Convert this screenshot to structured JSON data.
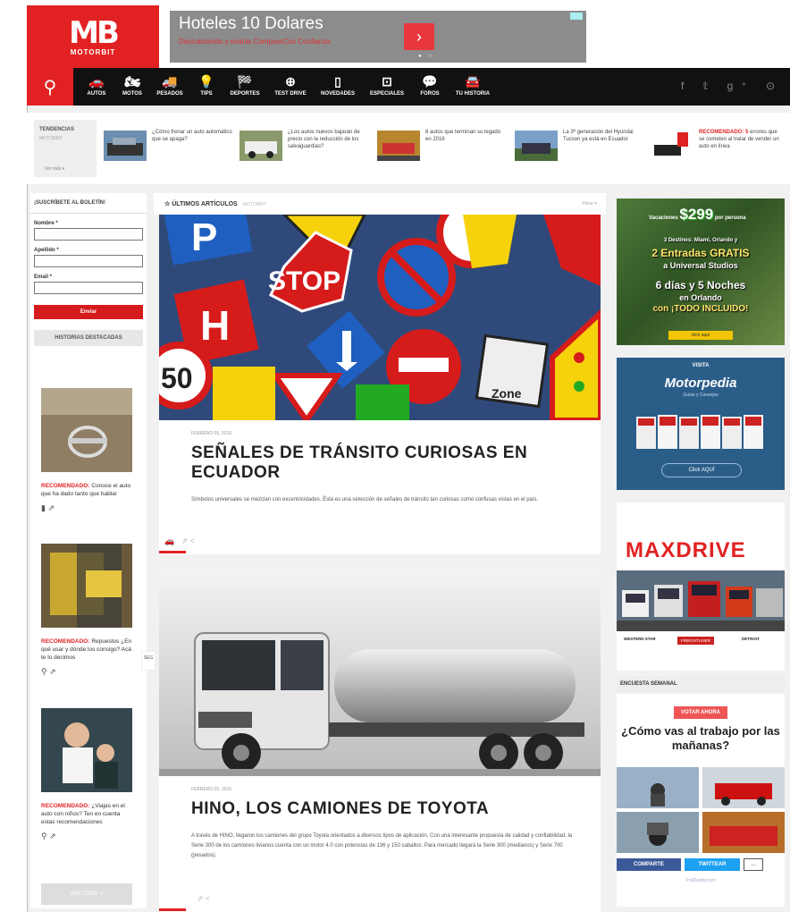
{
  "logo": {
    "mark": "MB",
    "sub": "MOTORBIT"
  },
  "top_ad": {
    "headline": "Hoteles 10 Dolares",
    "subline": "Descubriendo y evalúe CompareCon Confianza",
    "cta": "›"
  },
  "nav": {
    "items": [
      "AUTOS",
      "MOTOS",
      "PESADOS",
      "TIPS",
      "DEPORTES",
      "TEST DRIVE",
      "NOVEDADES",
      "ESPECIALES",
      "FOROS",
      "TU HISTORIA"
    ],
    "social": "f 𝕥 g⁺ ⊙"
  },
  "trending": {
    "label": "TENDENCIAS",
    "sub": "MOTORBIT",
    "more": "Ver más ▾",
    "items": [
      {
        "text": "¿Cómo frenar un auto automático que se apaga?",
        "rec": ""
      },
      {
        "text": "¿Los autos nuevos bajarán de precio con la reducción de los salvaguardias?",
        "rec": ""
      },
      {
        "text": "8 autos que terminan su legado en 2016",
        "rec": ""
      },
      {
        "text": "La 3ª generación del Hyundai Tucson ya está en Ecuador",
        "rec": ""
      },
      {
        "text": "errores que se cometen al tratar de vender un auto en línea",
        "rec": "RECOMENDADO: 5"
      }
    ]
  },
  "newsletter": {
    "title": "¡SUSCRÍBETE AL BOLETÍN!",
    "name_label": "Nombre *",
    "surname_label": "Apellido *",
    "email_label": "Email *",
    "submit": "Enviar"
  },
  "featured": {
    "title": "HISTORIAS DESTACADAS",
    "items": [
      {
        "rec": "RECOMENDADO:",
        "text": "Conoce el auto que ha dado tanto que hablar"
      },
      {
        "rec": "RECOMENDADO:",
        "text": "Repuestos ¿En qué usar y dónde los consigo? Acá te lo decimos"
      },
      {
        "rec": "RECOMENDADO:",
        "text": "¿Viajas en el auto con niños? Ten en cuenta estas recomendaciones"
      }
    ],
    "see_all": "VER TODO ➚"
  },
  "side_tag": "SEG",
  "articles_header": {
    "title": "☆ ÚLTIMOS ARTÍCULOS",
    "sub": "MOTORBIT",
    "filter": "Filtrar ▾"
  },
  "articles": [
    {
      "date": "FEBRERO 05, 2016",
      "title": "SEÑALES DE TRÁNSITO CURIOSAS EN ECUADOR",
      "desc": "Símbolos universales se mezclan con excentricidades. Ésta es una selección de señales de tránsito tan curiosas como confusas vistas en el país."
    },
    {
      "date": "FEBRERO 05, 2016",
      "title": "HINO, LOS CAMIONES DE TOYOTA",
      "desc": "A través de HINO, llegaron los camiones del grupo Toyota orientados a diversos tipos de aplicación. Con una interesante propuesta de calidad y confiabilidad, la Serie 300 de los camiones livianos cuenta con un motor 4.0 con potencias de 136 y 150 caballos. Para mercado llegará la Serie 300 (medianos) y Serie 700 (pesados)."
    }
  ],
  "ad_vacation": {
    "price_prefix": "Vacaciones",
    "price": "$299",
    "price_suffix": "por persona",
    "l1": "3 Destinos: Miami, Orlando y",
    "l2": "2 Entradas GRATIS",
    "l3": "a Universal Studios",
    "l4": "6 días y 5 Noches",
    "l5": "en Orlando",
    "l6": "con ¡TODO INCLUIDO!",
    "cta": "click aquí"
  },
  "ad_motorpedia": {
    "visit": "VISITA",
    "name": "Motorpedia",
    "sub": "Guías y Consejos",
    "click": "Click AQUÍ"
  },
  "ad_maxdrive": {
    "brand": "MAXDRIVE",
    "b1": "WESTERN STAR",
    "b2": "FREIGHTLINER",
    "b3": "DETROIT"
  },
  "poll": {
    "header": "ENCUESTA SEMANAL",
    "vote": "VOTAR AHORA",
    "question": "¿Cómo vas al trabajo por las mañanas?",
    "share1": "COMPARTE",
    "share2": "TWITTEAR",
    "share3": "...",
    "footer": "PollDaddy.com"
  },
  "colors": {
    "brand_red": "#e22222",
    "nav_bg": "#111111"
  }
}
